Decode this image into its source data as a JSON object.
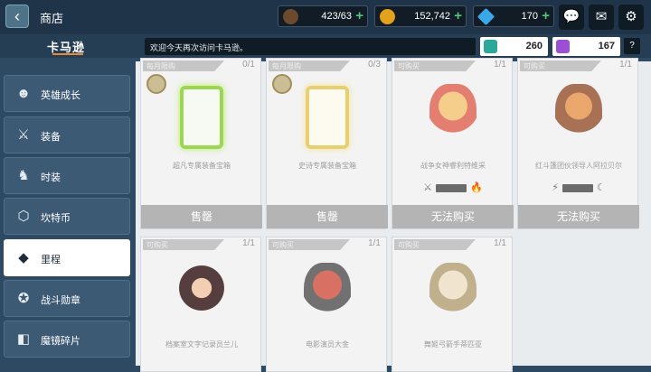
{
  "header": {
    "title": "商店",
    "back_icon": "back-arrow-icon"
  },
  "resources": [
    {
      "icon": "coffee-icon",
      "color": "#6b4a2e",
      "value": "423/63"
    },
    {
      "icon": "gold-coin-icon",
      "color": "#e2a21c",
      "value": "152,742"
    },
    {
      "icon": "gem-icon",
      "color": "#3aa8e8",
      "value": "170"
    }
  ],
  "header_buttons": [
    "chat-icon",
    "mail-icon",
    "gear-icon"
  ],
  "subbar": {
    "brand": "卡马逊",
    "ticker": "欢迎今天再次访问卡马逊。",
    "currency": [
      {
        "icon": "heart-crystal-icon",
        "color": "#2aa899",
        "value": "260"
      },
      {
        "icon": "ticket-icon",
        "color": "#9b4fd4",
        "value": "167"
      }
    ],
    "help": "?"
  },
  "sidebar": {
    "items": [
      {
        "label": "英雄成长",
        "icon": "hero-growth-icon",
        "glyph": "☻",
        "active": false
      },
      {
        "label": "装备",
        "icon": "sword-icon",
        "glyph": "⚔",
        "active": false
      },
      {
        "label": "时装",
        "icon": "costume-icon",
        "glyph": "♞",
        "active": false
      },
      {
        "label": "坎特币",
        "icon": "coin-icon",
        "glyph": "⬡",
        "active": false
      },
      {
        "label": "里程",
        "icon": "ticket-icon",
        "glyph": "◆",
        "active": true
      },
      {
        "label": "战斗勋章",
        "icon": "medal-icon",
        "glyph": "✪",
        "active": false
      },
      {
        "label": "魔镜碎片",
        "icon": "mirror-shard-icon",
        "glyph": "◧",
        "active": false
      }
    ]
  },
  "cards": [
    {
      "tag": "每月限购",
      "count": "0/1",
      "name": "超凡专属装备宝箱",
      "button": "售罄",
      "kind": "box-green"
    },
    {
      "tag": "每月限购",
      "count": "0/3",
      "name": "史诗专属装备宝箱",
      "button": "售罄",
      "kind": "box-gold"
    },
    {
      "tag": "可购买",
      "count": "1/1",
      "name": "战争女神睿利特维采",
      "button": "无法购买",
      "kind": "hero",
      "hero_color": "#f0a23a",
      "stats": "⚔ ★★☆☆☆ 🔥"
    },
    {
      "tag": "可购买",
      "count": "1/1",
      "name": "红斗篷团伙领导人阿拉贝尔",
      "button": "无法购买",
      "kind": "hero",
      "hero_color": "#c96a3a",
      "stats": "⚡ ★★☆☆☆ ☾"
    },
    {
      "tag": "可购买",
      "count": "1/1",
      "name": "档案室文字记录员兰儿",
      "button": "",
      "kind": "hero",
      "hero_color": "#7a2a2a"
    },
    {
      "tag": "可购买",
      "count": "1/1",
      "name": "电影演员大金",
      "button": "",
      "kind": "hero",
      "hero_color": "#c8463c"
    },
    {
      "tag": "可购买",
      "count": "1/1",
      "name": "舞姬弓箭手蒂匹亚",
      "button": "",
      "kind": "hero",
      "hero_color": "#e8dcc8"
    }
  ]
}
